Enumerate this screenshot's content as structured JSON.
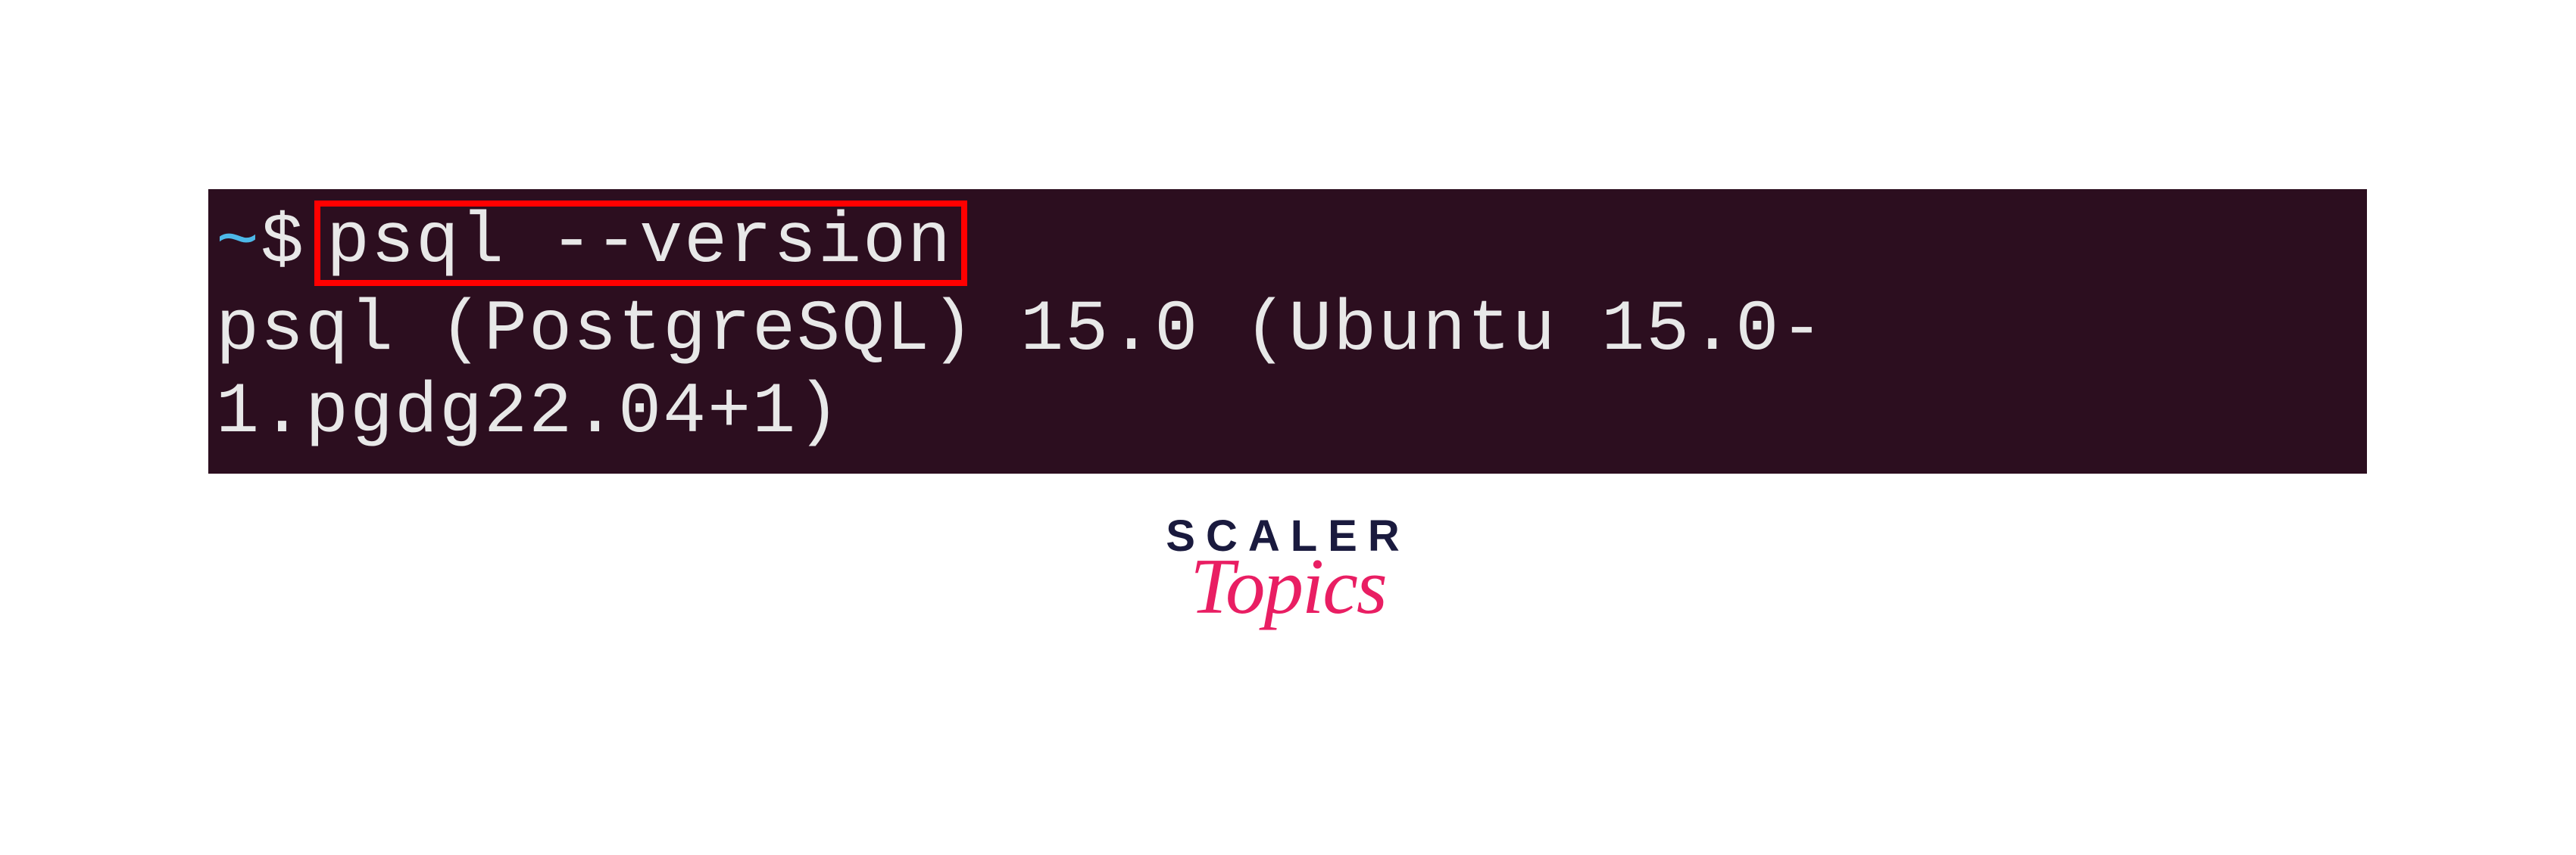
{
  "terminal": {
    "prompt_tilde": "~",
    "prompt_dollar": "$",
    "command": "psql --version",
    "output": "psql (PostgreSQL) 15.0 (Ubuntu 15.0-1.pgdg22.04+1)"
  },
  "logo": {
    "line1": "SCALER",
    "line2": "Topics"
  }
}
